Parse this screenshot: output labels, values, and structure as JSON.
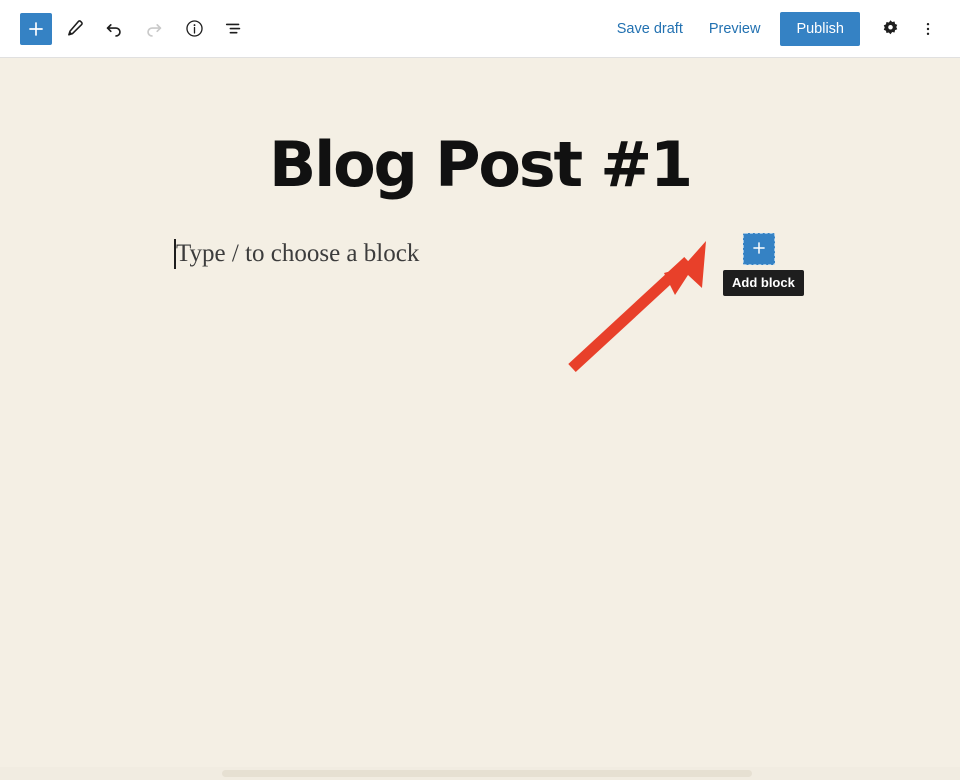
{
  "header": {
    "left_tools": [
      {
        "name": "block-inserter-toggle",
        "icon": "plus-icon",
        "label": "Toggle block inserter"
      },
      {
        "name": "tools-edit",
        "icon": "pencil-icon",
        "label": "Tools"
      },
      {
        "name": "undo",
        "icon": "undo-arrow-icon",
        "label": "Undo"
      },
      {
        "name": "redo",
        "icon": "redo-arrow-icon",
        "label": "Redo"
      },
      {
        "name": "details",
        "icon": "info-circle-icon",
        "label": "Details"
      },
      {
        "name": "list-view",
        "icon": "list-view-icon",
        "label": "List view"
      }
    ],
    "save_draft_label": "Save draft",
    "preview_label": "Preview",
    "publish_label": "Publish",
    "settings_icon": "gear-icon",
    "settings_label": "Settings",
    "more_menu_icon": "kebab-menu-icon",
    "more_menu_label": "Options"
  },
  "canvas": {
    "post_title": "Blog Post #1",
    "paragraph_placeholder": "Type / to choose a block",
    "add_block": {
      "icon": "plus-icon",
      "tooltip": "Add block"
    }
  },
  "colors": {
    "accent_blue": "#3582c4",
    "link_blue": "#2271b1",
    "canvas_bg": "#f4efe4",
    "header_bg": "#ffffff",
    "tooltip_bg": "#1e1e1e",
    "annotation_red": "#e8402a",
    "title_text": "#111111"
  },
  "annotation": {
    "arrow": "red-arrow-pointing-up-right-to-add-block-button"
  }
}
